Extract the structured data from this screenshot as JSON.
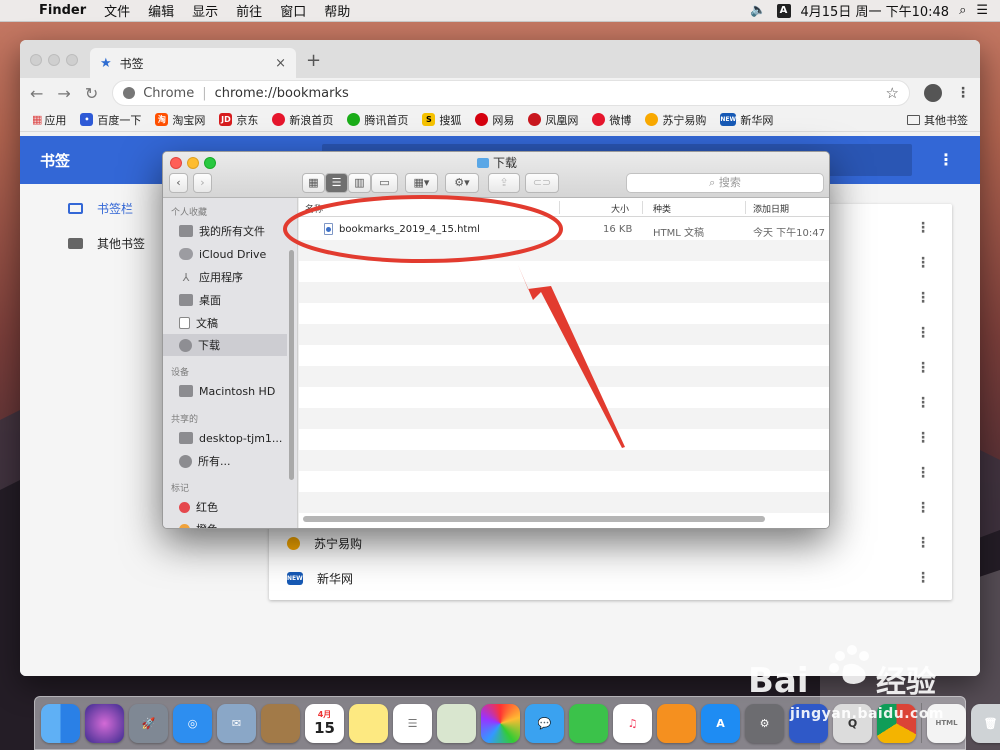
{
  "menubar": {
    "app": "Finder",
    "items": [
      "文件",
      "编辑",
      "显示",
      "前往",
      "窗口",
      "帮助"
    ],
    "ime": "A",
    "clock": "4月15日 周一 下午10:48"
  },
  "chrome": {
    "tab_title": "书签",
    "tab_close": "×",
    "new_tab": "+",
    "omnibox_origin": "Chrome",
    "omnibox_url": "chrome://bookmarks",
    "bookmarks_bar": [
      {
        "label": "应用",
        "color": "#5f6368"
      },
      {
        "label": "百度一下",
        "color": "#2e5ad6"
      },
      {
        "label": "淘宝网",
        "color": "#ff5000"
      },
      {
        "label": "京东",
        "color": "#d71c1e"
      },
      {
        "label": "新浪首页",
        "color": "#e6162d"
      },
      {
        "label": "腾讯首页",
        "color": "#1aad19"
      },
      {
        "label": "搜狐",
        "color": "#f6c200"
      },
      {
        "label": "网易",
        "color": "#d5000f"
      },
      {
        "label": "凤凰网",
        "color": "#c9171e"
      },
      {
        "label": "微博",
        "color": "#e6162d"
      },
      {
        "label": "苏宁易购",
        "color": "#f9a900"
      },
      {
        "label": "新华网",
        "color": "#1659b5"
      }
    ],
    "other_bookmarks": "其他书签"
  },
  "bookmarks_page": {
    "title": "书签",
    "folders": [
      "书签栏",
      "其他书签"
    ],
    "visible_rows": [
      {
        "label": "苏宁易购"
      },
      {
        "label": "新华网"
      }
    ]
  },
  "finder": {
    "title": "下载",
    "search_placeholder": "搜索",
    "sidebar": {
      "favorites_header": "个人收藏",
      "favorites": [
        "我的所有文件",
        "iCloud Drive",
        "应用程序",
        "桌面",
        "文稿",
        "下载"
      ],
      "devices_header": "设备",
      "devices": [
        "Macintosh HD"
      ],
      "shared_header": "共享的",
      "shared": [
        "desktop-tjm1...",
        "所有..."
      ],
      "tags_header": "标记",
      "tags": [
        {
          "label": "红色",
          "color": "#e5484d"
        },
        {
          "label": "橙色",
          "color": "#f0a23b"
        }
      ]
    },
    "columns": {
      "name": "名称",
      "size": "大小",
      "kind": "种类",
      "date": "添加日期"
    },
    "files": [
      {
        "name": "bookmarks_2019_4_15.html",
        "size": "16 KB",
        "kind": "HTML 文稿",
        "date": "今天 下午10:47"
      }
    ]
  },
  "watermark": {
    "brand": "Bai",
    "brand2": "经验",
    "url": "jingyan.baidu.com"
  },
  "dock": {
    "calendar_day": "15",
    "calendar_month": "4月"
  }
}
